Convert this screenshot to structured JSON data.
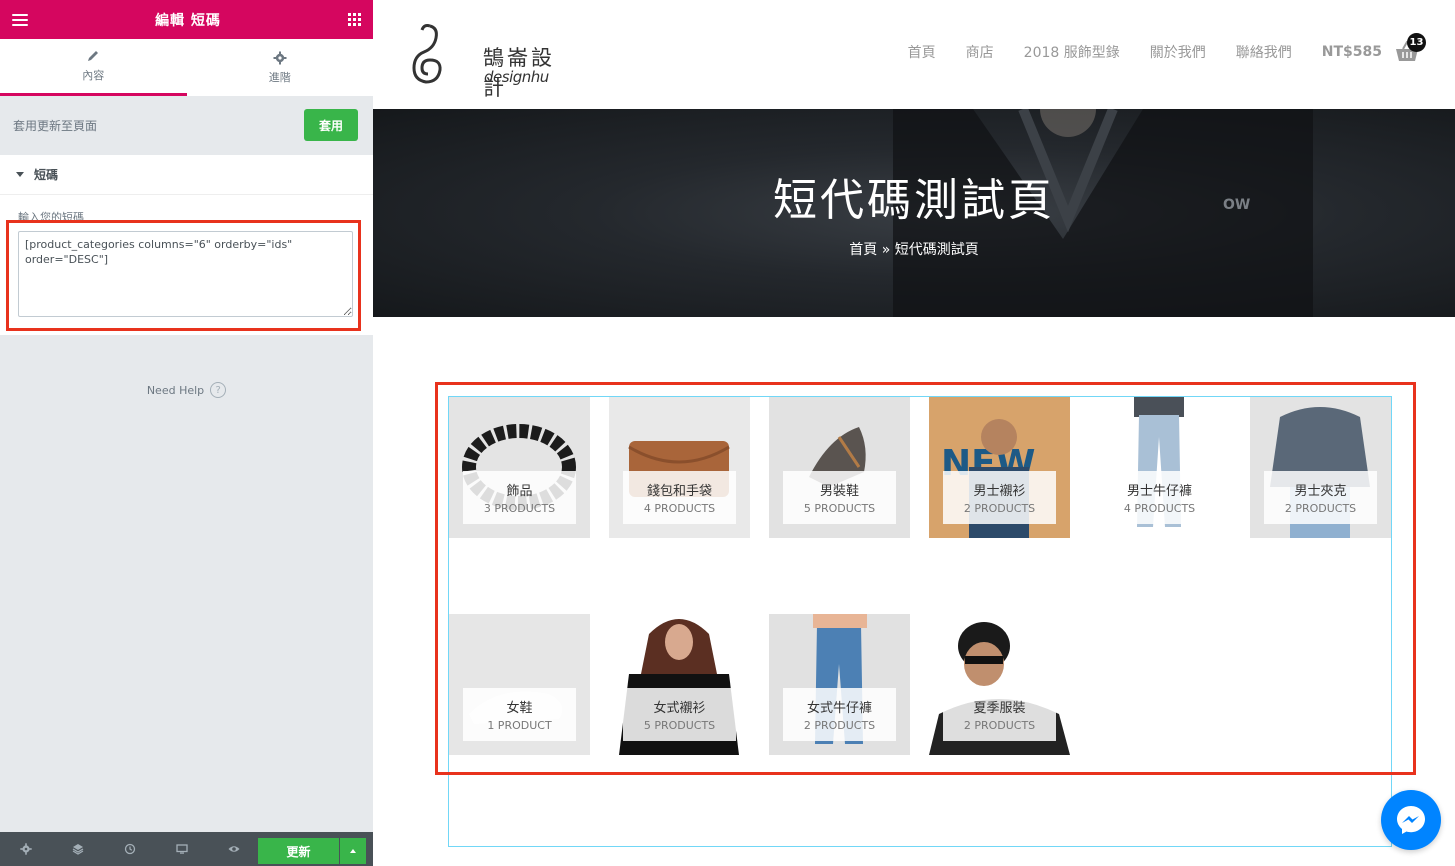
{
  "panel": {
    "title": "編輯 短碼",
    "tabs": [
      {
        "label": "內容",
        "icon": "pencil-icon"
      },
      {
        "label": "進階",
        "icon": "gear-icon"
      }
    ],
    "apply": {
      "label": "套用更新至頁面",
      "button": "套用"
    },
    "section": "短碼",
    "control_label": "輸入您的短碼",
    "shortcode_value": "[product_categories columns=\"6\" orderby=\"ids\" order=\"DESC\"]",
    "need_help": "Need Help",
    "update_button": "更新",
    "accent_color": "#d5065f",
    "button_color": "#39b54a"
  },
  "site": {
    "logo_cn": "鵠崙設計",
    "logo_en": "designhu",
    "nav": [
      "首頁",
      "商店",
      "2018 服飾型錄",
      "關於我們",
      "聯絡我們"
    ],
    "cart_total": "NT$585",
    "cart_count": "13",
    "hero_title": "短代碼測試頁",
    "breadcrumb": {
      "home": "首頁",
      "separator": " » ",
      "current": "短代碼測試頁"
    },
    "categories": [
      {
        "name": "飾品",
        "count": "3 PRODUCTS"
      },
      {
        "name": "錢包和手袋",
        "count": "4 PRODUCTS"
      },
      {
        "name": "男裝鞋",
        "count": "5 PRODUCTS"
      },
      {
        "name": "男士襯衫",
        "count": "2 PRODUCTS"
      },
      {
        "name": "男士牛仔褲",
        "count": "4 PRODUCTS"
      },
      {
        "name": "男士夾克",
        "count": "2 PRODUCTS"
      },
      {
        "name": "女鞋",
        "count": "1 PRODUCT"
      },
      {
        "name": "女式襯衫",
        "count": "5 PRODUCTS"
      },
      {
        "name": "女式牛仔褲",
        "count": "2 PRODUCTS"
      },
      {
        "name": "夏季服裝",
        "count": "2 PRODUCTS"
      }
    ]
  }
}
